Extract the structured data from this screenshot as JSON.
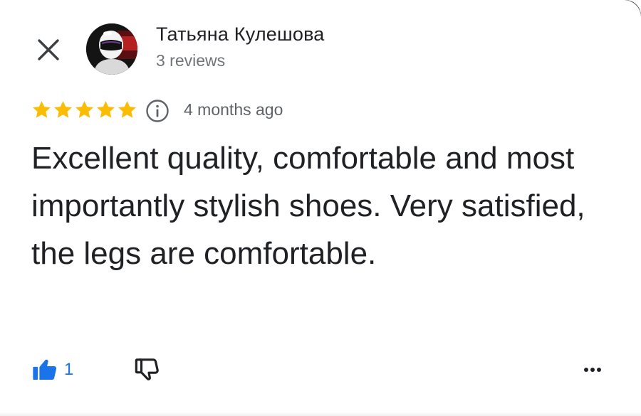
{
  "review": {
    "author_name": "Татьяна Кулешова",
    "author_meta": "3 reviews",
    "rating": 5,
    "rating_max": 5,
    "date": "4 months ago",
    "text": "Excellent quality, comfortable and most importantly stylish shoes. Very satisfied, the legs are comfortable.",
    "like_count": "1"
  },
  "icons": {
    "close": "close-icon",
    "avatar": "avatar-helmet-image",
    "star": "star-icon",
    "info": "info-icon",
    "like": "thumbs-up-icon",
    "dislike": "thumbs-down-icon",
    "more": "more-horiz-icon"
  },
  "colors": {
    "star": "#fbbc04",
    "like": "#1a73e8",
    "text": "#202124",
    "meta": "#70757a"
  }
}
